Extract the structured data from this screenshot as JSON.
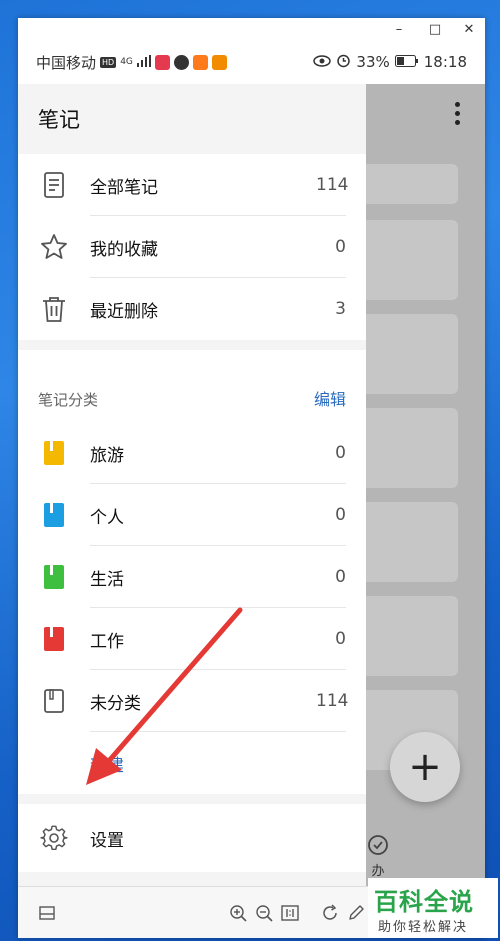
{
  "window": {
    "minimize": "–",
    "maximize": "□",
    "close": "✕"
  },
  "statusbar": {
    "carrier": "中国移动",
    "hd": "HD",
    "signal": "4G",
    "battery": "33%",
    "time": "18:18"
  },
  "drawer": {
    "title": "笔记",
    "top_items": [
      {
        "label": "全部笔记",
        "count": "114",
        "icon": "note-icon"
      },
      {
        "label": "我的收藏",
        "count": "0",
        "icon": "star-icon"
      },
      {
        "label": "最近删除",
        "count": "3",
        "icon": "trash-icon"
      }
    ],
    "category_header": "笔记分类",
    "edit_label": "编辑",
    "categories": [
      {
        "label": "旅游",
        "count": "0",
        "color": "#f5b800"
      },
      {
        "label": "个人",
        "count": "0",
        "color": "#1b9ee2"
      },
      {
        "label": "生活",
        "count": "0",
        "color": "#3fbf3f"
      },
      {
        "label": "工作",
        "count": "0",
        "color": "#e53935"
      },
      {
        "label": "未分类",
        "count": "114",
        "color": "#555555"
      }
    ],
    "new_label": "新建",
    "settings_label": "设置"
  },
  "background": {
    "fab": "+",
    "action_label": "办"
  },
  "watermark": {
    "main": "百科全说",
    "sub": "助你轻松解决"
  },
  "colors": {
    "accent": "#2a6bbf",
    "arrow": "#e53935"
  }
}
